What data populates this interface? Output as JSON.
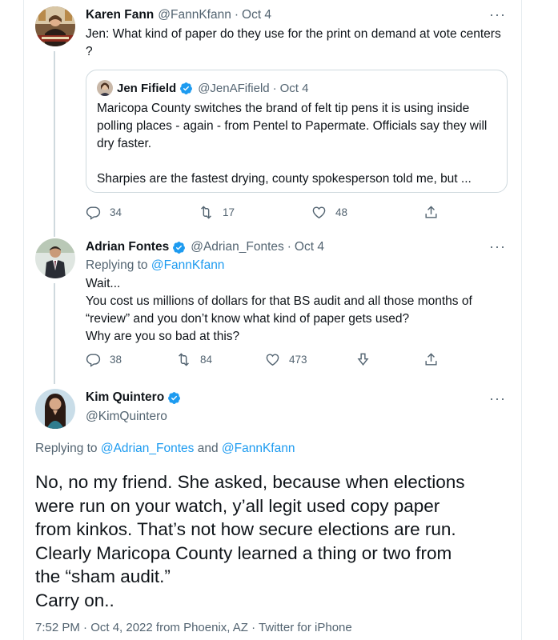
{
  "colors": {
    "link": "#1d9bf0",
    "muted": "#536471",
    "text": "#0f1419",
    "verified": "#1d9bf0"
  },
  "tweet1": {
    "name": "Karen Fann",
    "handle": "@FannKfann",
    "date": "Oct 4",
    "more": "···",
    "text_line1": "Jen: What kind of paper do they use for the print on demand at vote centers",
    "text_line2": "?",
    "quote": {
      "name": "Jen Fifield",
      "handle": "@JenAFifield",
      "date": "Oct 4",
      "lines": [
        "Maricopa County switches the brand of felt tip pens it is using inside",
        "polling places - again - from Pentel to Papermate. Officials say they will",
        "dry faster.",
        "",
        "Sharpies are the fastest drying, county spokesperson told me, but ..."
      ]
    },
    "actions": {
      "replies": "34",
      "retweets": "17",
      "likes": "48"
    }
  },
  "tweet2": {
    "name": "Adrian Fontes",
    "handle": "@Adrian_Fontes",
    "date": "Oct 4",
    "more": "···",
    "replying_prefix": "Replying to ",
    "replying_to": "@FannKfann",
    "lines": [
      "Wait...",
      "You cost us millions of dollars for that BS audit and all those months of",
      "“review” and you don’t know what kind of paper gets used?",
      "Why are you so bad at this?"
    ],
    "actions": {
      "replies": "38",
      "retweets": "84",
      "likes": "473"
    }
  },
  "tweet3": {
    "name": "Kim Quintero",
    "handle": "@KimQuintero",
    "more": "···",
    "replying_prefix": "Replying to ",
    "replying_to_1": "@Adrian_Fontes",
    "replying_and": " and ",
    "replying_to_2": "@FannKfann",
    "lines": [
      "No, no my friend. She asked, because when elections",
      "were run on your watch, y’all legit used copy paper",
      "from kinkos. That’s not how secure elections are run.",
      "Clearly Maricopa County learned a thing or two from",
      "the “sham audit.”",
      "Carry on.."
    ],
    "meta": "7:52 PM · Oct 4, 2022 from Phoenix, AZ · Twitter for iPhone"
  }
}
